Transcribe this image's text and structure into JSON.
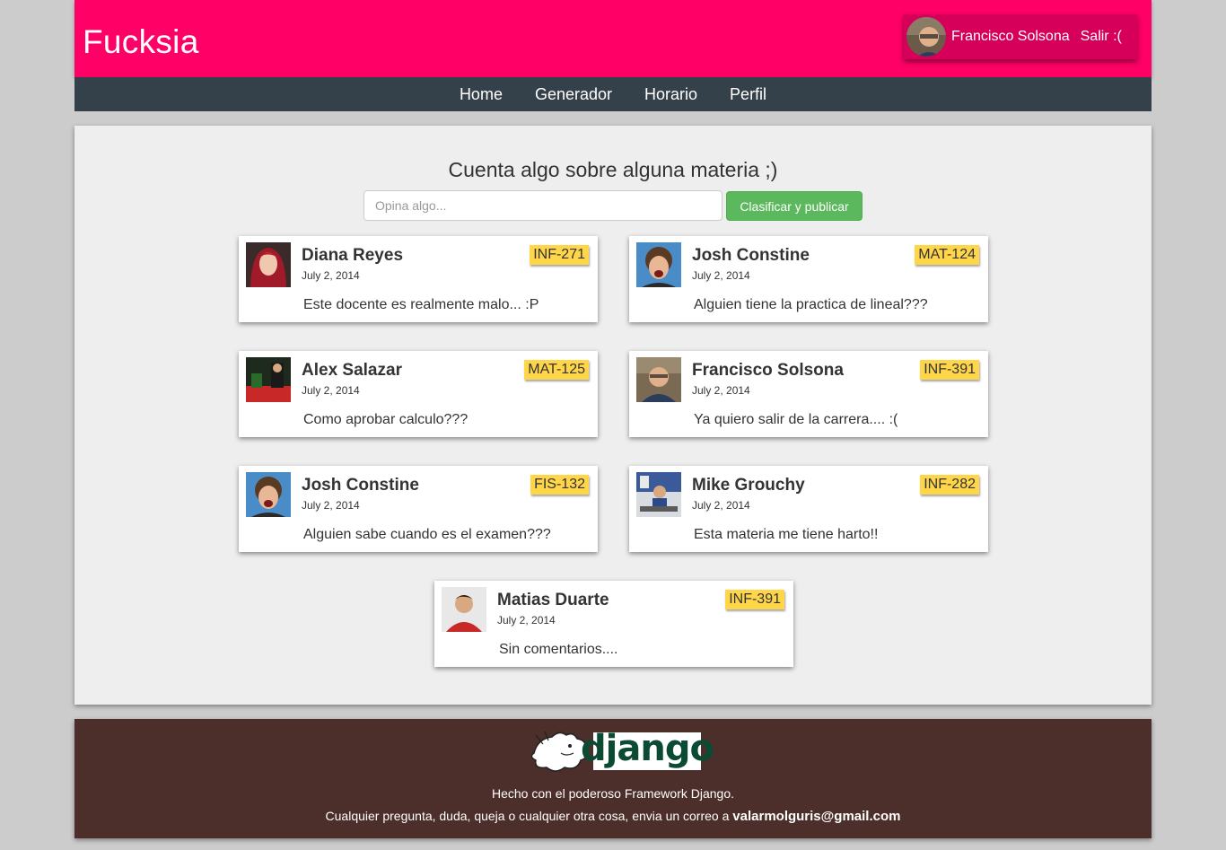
{
  "header": {
    "brand": "Fucksia",
    "user_name": "Francisco Solsona",
    "logout_label": "Salir :(",
    "brand_color": "#ff0066"
  },
  "nav": {
    "items": [
      {
        "label": "Home"
      },
      {
        "label": "Generador"
      },
      {
        "label": "Horario"
      },
      {
        "label": "Perfil"
      }
    ]
  },
  "composer": {
    "title": "Cuenta algo sobre alguna materia ;)",
    "placeholder": "Opina algo...",
    "value": "",
    "button_label": "Clasificar y publicar"
  },
  "posts": [
    {
      "name": "Diana Reyes",
      "date": "July 2, 2014",
      "tag": "INF-271",
      "text": "Este docente es realmente malo... :P",
      "avatar": "woman-red-hair"
    },
    {
      "name": "Josh Constine",
      "date": "July 2, 2014",
      "tag": "MAT-124",
      "text": "Alguien tiene la practica de lineal???",
      "avatar": "man-curly-hair"
    },
    {
      "name": "Alex Salazar",
      "date": "July 2, 2014",
      "tag": "MAT-125",
      "text": "Como aprobar calculo???",
      "avatar": "man-stage"
    },
    {
      "name": "Francisco Solsona",
      "date": "July 2, 2014",
      "tag": "INF-391",
      "text": "Ya quiero salir de la carrera.... :(",
      "avatar": "man-glasses"
    },
    {
      "name": "Josh Constine",
      "date": "July 2, 2014",
      "tag": "FIS-132",
      "text": "Alguien sabe cuando es el examen???",
      "avatar": "man-curly-hair"
    },
    {
      "name": "Mike Grouchy",
      "date": "July 2, 2014",
      "tag": "INF-282",
      "text": "Esta materia me tiene harto!!",
      "avatar": "man-sitting"
    },
    {
      "name": "Matias Duarte",
      "date": "July 2, 2014",
      "tag": "INF-391",
      "text": "Sin comentarios....",
      "avatar": "man-red-shirt"
    }
  ],
  "footer": {
    "django_logo_text": "django",
    "line1": "Hecho con el poderoso Framework Django.",
    "line2_prefix": "Cualquier pregunta, duda, queja o cualquier otra cosa, envia un correo a ",
    "email": "valarmolguris@gmail.com"
  },
  "colors": {
    "nav_bg": "#34414a",
    "footer_bg": "#4c2e2a",
    "tag_bg": "#ffd54a",
    "button_bg": "#5cb85c"
  }
}
